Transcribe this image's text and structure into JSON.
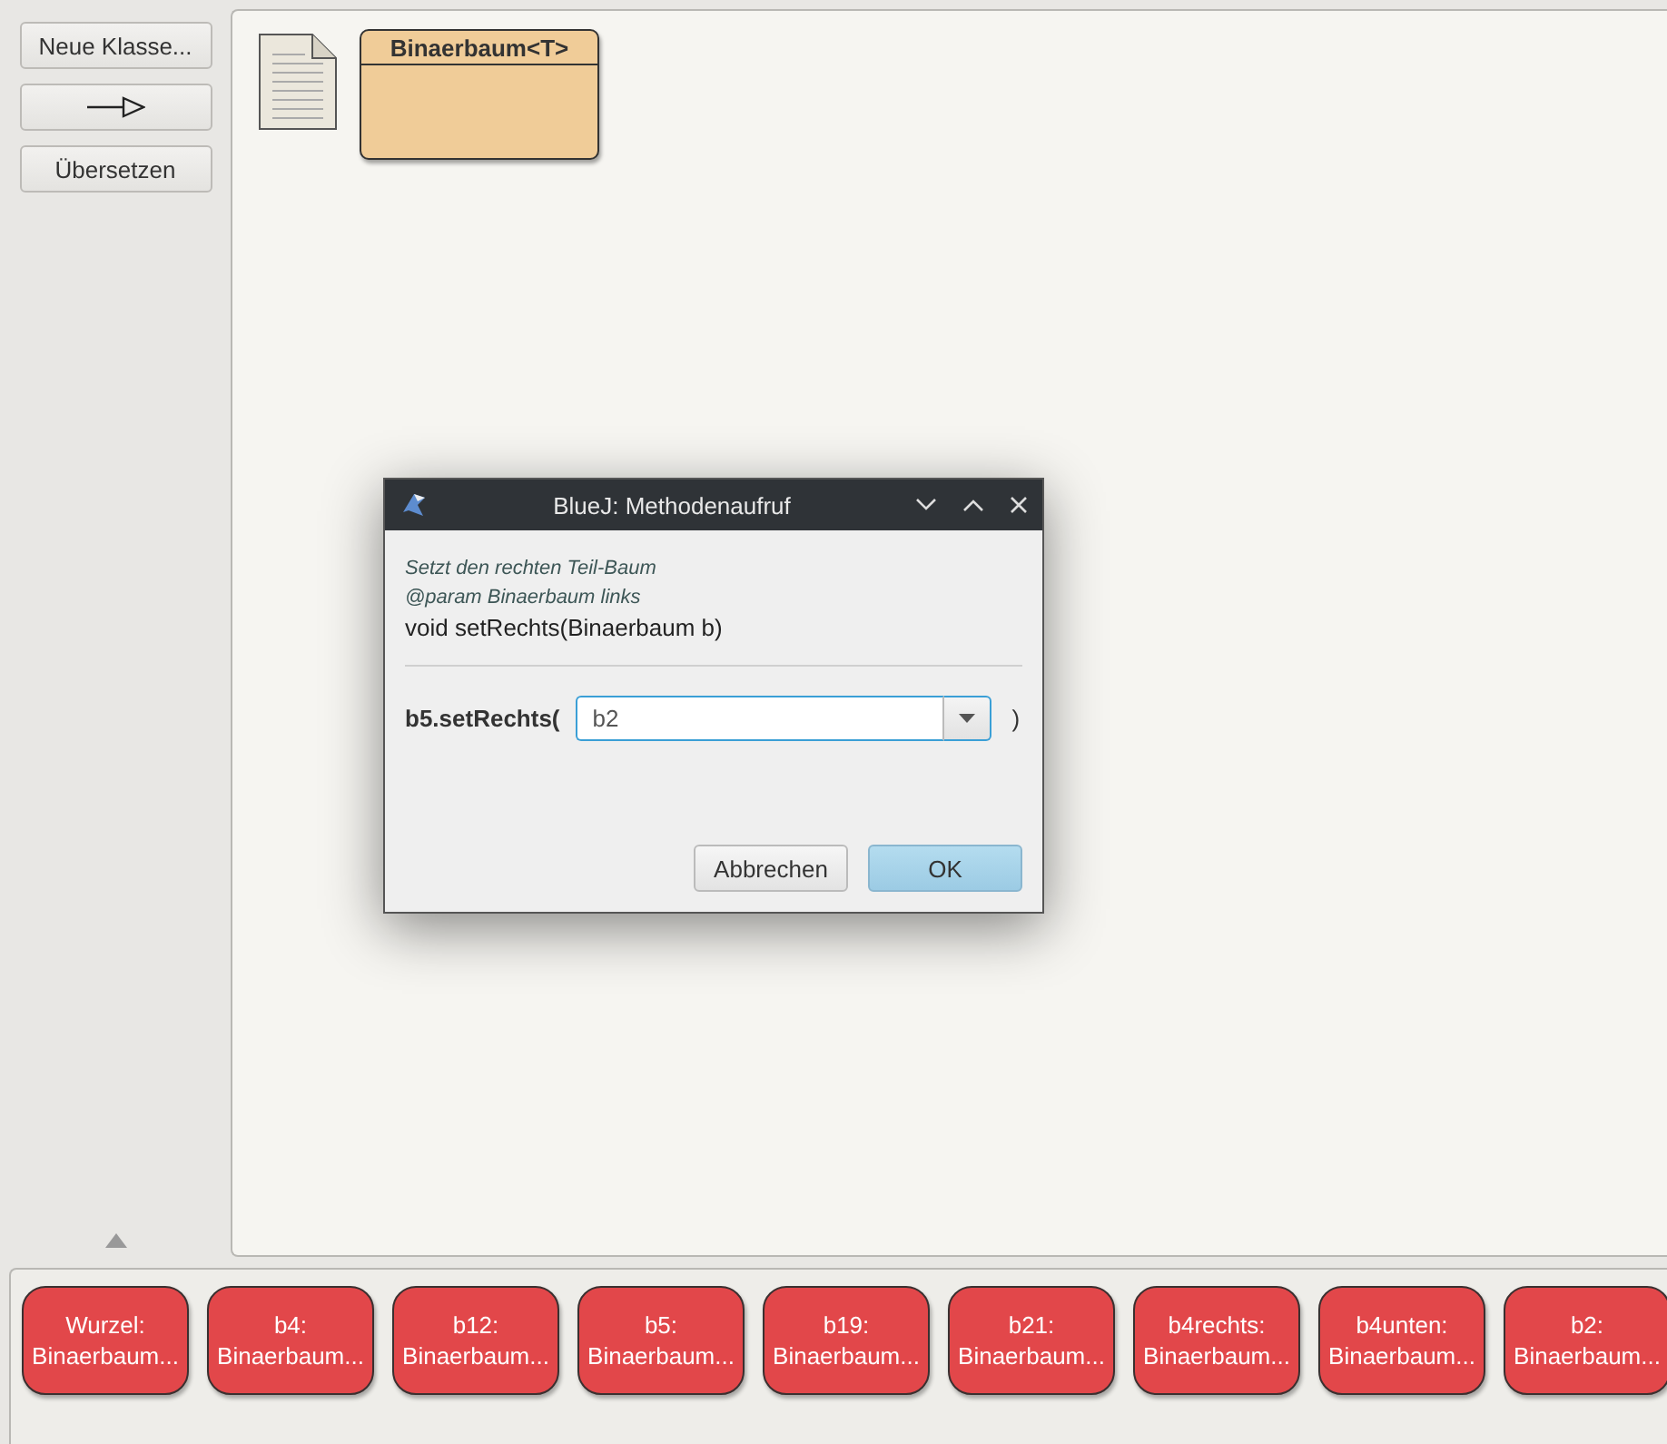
{
  "toolbar": {
    "buttons": [
      {
        "kind": "text",
        "label": "Neue Klasse..."
      },
      {
        "kind": "arrow"
      },
      {
        "kind": "text",
        "label": "Übersetzen"
      }
    ]
  },
  "diagram": {
    "classes": [
      {
        "name": "Binaerbaum<T>"
      }
    ]
  },
  "dialog": {
    "title": "BlueJ: Methodenaufruf",
    "comment_lines": [
      "Setzt den rechten Teil-Baum",
      "@param Binaerbaum links"
    ],
    "signature": "void setRechts(Binaerbaum b)",
    "call_prefix": "b5.setRechts(",
    "argument": {
      "value": "b2"
    },
    "call_suffix": ")",
    "buttons": [
      {
        "label": "Abbrechen",
        "default": false
      },
      {
        "label": "OK",
        "default": true
      }
    ]
  },
  "object_bench": {
    "objects": [
      {
        "name": "Wurzel:",
        "type": "Binaerbaum..."
      },
      {
        "name": "b4:",
        "type": "Binaerbaum..."
      },
      {
        "name": "b12:",
        "type": "Binaerbaum..."
      },
      {
        "name": "b5:",
        "type": "Binaerbaum..."
      },
      {
        "name": "b19:",
        "type": "Binaerbaum..."
      },
      {
        "name": "b21:",
        "type": "Binaerbaum..."
      },
      {
        "name": "b4rechts:",
        "type": "Binaerbaum..."
      },
      {
        "name": "b4unten:",
        "type": "Binaerbaum..."
      },
      {
        "name": "b2:",
        "type": "Binaerbaum..."
      }
    ]
  }
}
